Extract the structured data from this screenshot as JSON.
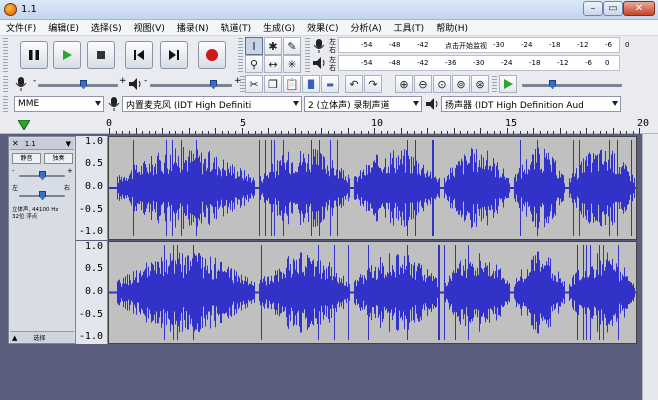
{
  "window": {
    "title": "1.1"
  },
  "menu": [
    "文件(F)",
    "编辑(E)",
    "选择(S)",
    "视图(V)",
    "播录(N)",
    "轨道(T)",
    "生成(G)",
    "效果(C)",
    "分析(A)",
    "工具(T)",
    "帮助(H)"
  ],
  "transport": {
    "pause": "pause",
    "play": "play",
    "stop": "stop",
    "skip_start": "skip-start",
    "skip_end": "skip-end",
    "record": "record"
  },
  "tools": {
    "row1": [
      "I",
      "✱",
      "✎"
    ],
    "row2": [
      "🔍",
      "↔",
      "✳"
    ]
  },
  "meters": {
    "record_labels": [
      "左",
      "右"
    ],
    "play_labels": [
      "左",
      "右"
    ],
    "ticks": [
      "-54",
      "-48",
      "-42",
      "-36",
      "-30",
      "-24",
      "-18",
      "-12",
      "-6",
      "0"
    ],
    "monitor_text": "点击开始监视"
  },
  "mixer": {
    "mic_plus": "+",
    "mic_minus": "-",
    "spk_plus": "+",
    "spk_minus": "-"
  },
  "device_bar": {
    "host": "MME",
    "recording_device": "内置麦克风 (IDT High Definiti",
    "channels": "2 (立体声) 录制声道",
    "playback_device": "扬声器 (IDT High Definition Aud"
  },
  "ruler": {
    "labels": [
      "0",
      "5",
      "10",
      "15",
      "20"
    ]
  },
  "track": {
    "name": "1.1",
    "mute_label": "静音",
    "solo_label": "独奏",
    "gain_minus": "-",
    "gain_plus": "+",
    "pan_left": "左",
    "pan_right": "右",
    "info_line1": "立体声, 44100 Hz",
    "info_line2": "32位 浮点",
    "select_label": "选择",
    "scale_labels": [
      "1.0",
      "0.5",
      "0.0",
      "-0.5",
      "-1.0"
    ]
  },
  "colors": {
    "waveform": "#3232c8",
    "record": "#d01818",
    "play": "#2fa52f",
    "background": "#5a5d7c"
  }
}
